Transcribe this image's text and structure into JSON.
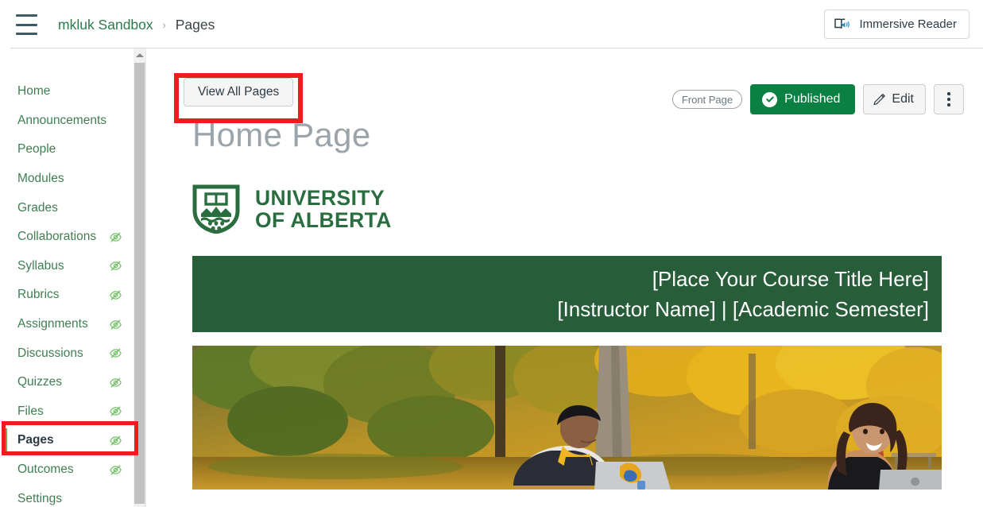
{
  "header": {
    "menu_icon": "hamburger-menu-icon",
    "breadcrumb": {
      "course": "mkluk Sandbox",
      "separator": "›",
      "current": "Pages"
    },
    "immersive_reader_label": "Immersive Reader",
    "immersive_reader_icon": "immersive-reader-icon"
  },
  "sidebar": {
    "items": [
      {
        "label": "Home",
        "hidden_icon": false,
        "active": false
      },
      {
        "label": "Announcements",
        "hidden_icon": false,
        "active": false
      },
      {
        "label": "People",
        "hidden_icon": false,
        "active": false
      },
      {
        "label": "Modules",
        "hidden_icon": false,
        "active": false
      },
      {
        "label": "Grades",
        "hidden_icon": false,
        "active": false
      },
      {
        "label": "Collaborations",
        "hidden_icon": true,
        "active": false
      },
      {
        "label": "Syllabus",
        "hidden_icon": true,
        "active": false
      },
      {
        "label": "Rubrics",
        "hidden_icon": true,
        "active": false
      },
      {
        "label": "Assignments",
        "hidden_icon": true,
        "active": false
      },
      {
        "label": "Discussions",
        "hidden_icon": true,
        "active": false
      },
      {
        "label": "Quizzes",
        "hidden_icon": true,
        "active": false
      },
      {
        "label": "Files",
        "hidden_icon": true,
        "active": false
      },
      {
        "label": "Pages",
        "hidden_icon": true,
        "active": true
      },
      {
        "label": "Outcomes",
        "hidden_icon": true,
        "active": false
      },
      {
        "label": "Settings",
        "hidden_icon": false,
        "active": false
      }
    ],
    "hidden_icon_name": "eye-slash-hidden-icon",
    "scrollbar_up_icon": "scroll-up-arrow-icon"
  },
  "toolbar": {
    "view_all_pages_label": "View All Pages",
    "front_page_badge": "Front Page",
    "published_label": "Published",
    "published_icon": "check-circle-icon",
    "edit_label": "Edit",
    "edit_icon": "pencil-icon",
    "more_options_icon": "kebab-menu-icon"
  },
  "page": {
    "title": "Home Page",
    "logo": {
      "icon_name": "university-of-alberta-shield-icon",
      "line1": "UNIVERSITY",
      "line2": "OF ALBERTA"
    },
    "banner": {
      "course_title": "[Place Your Course Title Here]",
      "instructor_semester": "[Instructor Name] | [Academic Semester]"
    },
    "hero_image_alt": "students-on-campus-autumn-photo"
  },
  "annotations": {
    "highlight_color": "#ee1c1c",
    "boxes": [
      {
        "target": "view-all-pages-button"
      },
      {
        "target": "sidebar-item-pages"
      }
    ]
  },
  "colors": {
    "brand_green": "#2d7a4d",
    "nav_link_green": "#3f7e52",
    "banner_green": "#275d38",
    "published_green": "#0b8043",
    "active_bar_green": "#5ab54a",
    "title_gray": "#9aa4ab",
    "logo_green": "#2a6e3f"
  }
}
